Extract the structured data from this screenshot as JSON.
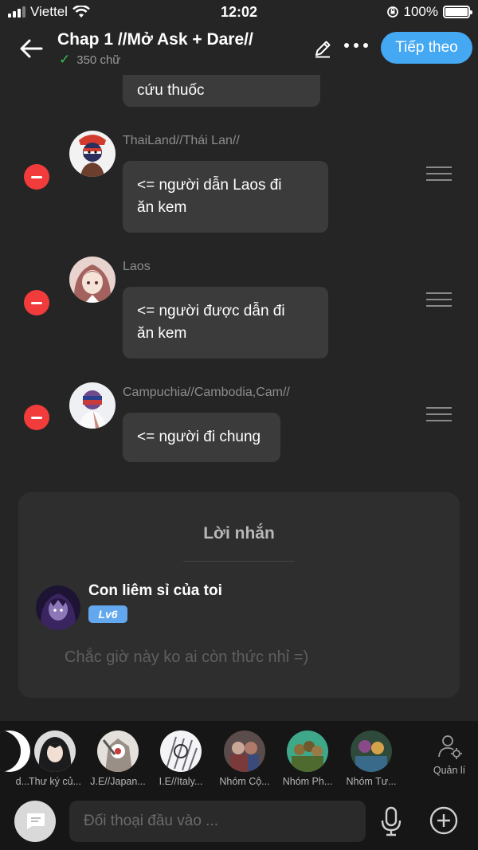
{
  "status_bar": {
    "carrier": "Viettel",
    "time": "12:02",
    "battery": "100%"
  },
  "header": {
    "title": "Chap 1 //Mở Ask + Dare//",
    "word_count": "350 chữ",
    "next_label": "Tiếp theo"
  },
  "chat": {
    "previous_text": "cứu thuốc",
    "messages": [
      {
        "name": "ThaiLand//Thái Lan//",
        "text": [
          "<= người dẫn Laos đi",
          "ăn kem"
        ]
      },
      {
        "name": "Laos",
        "text": [
          "<= người được dẫn đi",
          "ăn kem"
        ]
      },
      {
        "name": "Campuchia//Cambodia,Cam//",
        "text": [
          "<= người đi chung"
        ]
      }
    ]
  },
  "note": {
    "title": "Lời nhắn",
    "user": "Con liêm sỉ của toi",
    "level": "Lv6",
    "placeholder": "Chắc giờ này ko ai còn thức nhỉ =)"
  },
  "characters": [
    {
      "label": "d..."
    },
    {
      "label": "Thư ký củ..."
    },
    {
      "label": "J.E//Japan..."
    },
    {
      "label": "I.E//Italy..."
    },
    {
      "label": "Nhóm Cộ..."
    },
    {
      "label": "Nhóm Ph..."
    },
    {
      "label": "Nhóm Tư..."
    }
  ],
  "manage_label": "Quản lí",
  "composer": {
    "placeholder": "Đối thoại đầu vào ..."
  },
  "colors": {
    "accent": "#44a8f2",
    "delete": "#f23b3b",
    "level_badge": "#63a8ef",
    "background": "#252526"
  }
}
